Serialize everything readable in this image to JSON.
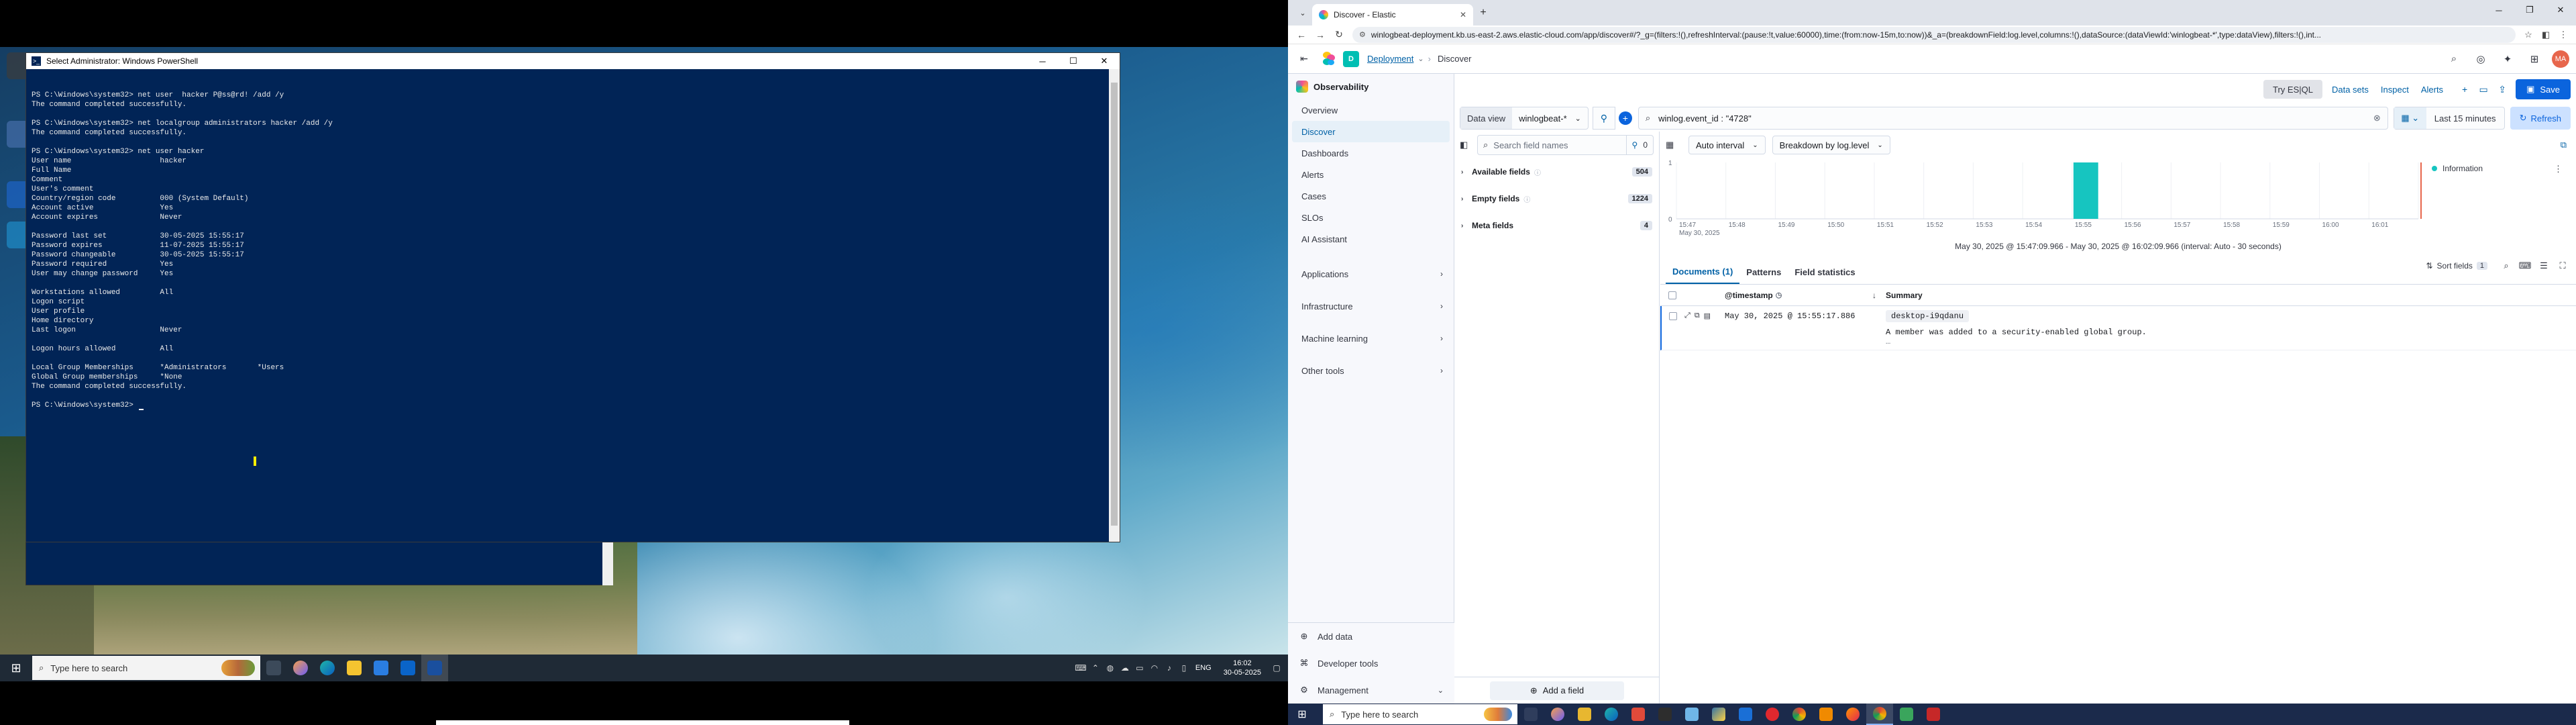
{
  "left": {
    "powershell": {
      "title": "Select Administrator: Windows PowerShell",
      "lines": [
        "PS C:\\Windows\\system32> net user  hacker P@ss@rd! /add /y",
        "The command completed successfully.",
        "",
        "PS C:\\Windows\\system32> net localgroup administrators hacker /add /y",
        "The command completed successfully.",
        "",
        "PS C:\\Windows\\system32> net user hacker",
        "User name                    hacker",
        "Full Name",
        "Comment",
        "User's comment",
        "Country/region code          000 (System Default)",
        "Account active               Yes",
        "Account expires              Never",
        "",
        "Password last set            30-05-2025 15:55:17",
        "Password expires             11-07-2025 15:55:17",
        "Password changeable          30-05-2025 15:55:17",
        "Password required            Yes",
        "User may change password     Yes",
        "",
        "Workstations allowed         All",
        "Logon script",
        "User profile",
        "Home directory",
        "Last logon                   Never",
        "",
        "Logon hours allowed          All",
        "",
        "Local Group Memberships      *Administrators       *Users",
        "Global Group memberships     *None",
        "The command completed successfully.",
        "",
        "PS C:\\Windows\\system32> "
      ]
    },
    "taskbar": {
      "search_placeholder": "Type here to search",
      "tray": {
        "lang": "ENG",
        "time": "16:02",
        "date": "30-05-2025"
      }
    }
  },
  "right": {
    "browser": {
      "tab_title": "Discover - Elastic",
      "url": "winlogbeat-deployment.kb.us-east-2.aws.elastic-cloud.com/app/discover#/?_g=(filters:!(),refreshInterval:(pause:!t,value:60000),time:(from:now-15m,to:now))&_a=(breakdownField:log.level,columns:!(),dataSource:(dataViewId:'winlogbeat-*',type:dataView),filters:!(),int..."
    },
    "kibana": {
      "breadcrumbs": [
        "Deployment",
        "Discover"
      ],
      "avatar": "MA",
      "nav": {
        "solution": "Observability",
        "items": [
          "Overview",
          "Discover",
          "Dashboards",
          "Alerts",
          "Cases",
          "SLOs",
          "AI Assistant"
        ],
        "active": "Discover",
        "groups": [
          "Applications",
          "Infrastructure",
          "Machine learning",
          "Other tools"
        ],
        "footer": [
          "Add data",
          "Developer tools",
          "Management"
        ]
      },
      "actions": {
        "try_esql": "Try ES|QL",
        "data_sets": "Data sets",
        "inspect": "Inspect",
        "alerts": "Alerts",
        "save": "Save"
      },
      "query": {
        "data_view_label": "Data view",
        "data_view_value": "winlogbeat-*",
        "kql": "winlog.event_id : \"4728\"",
        "time_range": "Last 15 minutes",
        "refresh": "Refresh"
      },
      "fields": {
        "search_placeholder": "Search field names",
        "filter_count": "0",
        "groups": [
          {
            "label": "Available fields",
            "count": "504"
          },
          {
            "label": "Empty fields",
            "count": "1224"
          },
          {
            "label": "Meta fields",
            "count": "4"
          }
        ],
        "add_field": "Add a field"
      },
      "chart_toolbar": {
        "interval": "Auto interval",
        "breakdown": "Breakdown by log.level"
      },
      "histogram": {
        "legend": "Information",
        "color": "#16c5c0",
        "range_text": "May 30, 2025 @ 15:47:09.966 - May 30, 2025 @ 16:02:09.966 (interval: Auto - 30 seconds)"
      },
      "chart_data": {
        "type": "bar",
        "title": "",
        "xlabel": "",
        "ylabel": "",
        "categories": [
          "15:47",
          "15:48",
          "15:49",
          "15:50",
          "15:51",
          "15:52",
          "15:53",
          "15:54",
          "15:55",
          "15:56",
          "15:57",
          "15:58",
          "15:59",
          "16:00",
          "16:01"
        ],
        "first_tick_sublabel": "May 30, 2025",
        "series": [
          {
            "name": "Information",
            "values": [
              0,
              0,
              0,
              0,
              0,
              0,
              0,
              0,
              1,
              0,
              0,
              0,
              0,
              0,
              0
            ]
          }
        ],
        "ylim": [
          0,
          1
        ],
        "ytick_labels": [
          "0",
          "1"
        ]
      },
      "documents": {
        "tabs": [
          "Documents (1)",
          "Patterns",
          "Field statistics"
        ],
        "sort_fields": "Sort fields",
        "sort_count": "1",
        "columns": {
          "timestamp": "@timestamp",
          "summary": "Summary"
        },
        "rows": [
          {
            "timestamp": "May 30, 2025 @ 15:55:17.886",
            "host": "desktop-i9qdanu",
            "message": "A member was added to a security-enabled global group.",
            "more": "…"
          }
        ]
      }
    },
    "taskbar": {
      "search_placeholder": "Type here to search"
    }
  }
}
